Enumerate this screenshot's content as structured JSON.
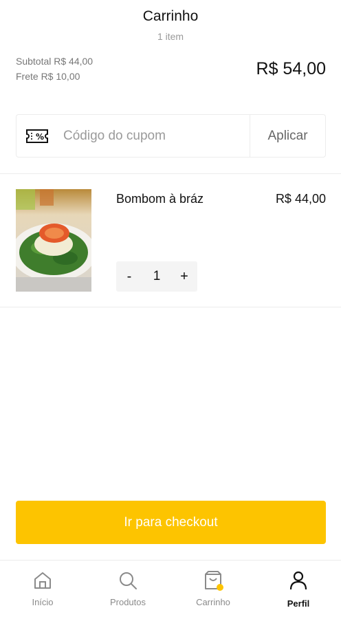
{
  "header": {
    "title": "Carrinho",
    "subtitle": "1 item"
  },
  "summary": {
    "subtotal": "Subtotal R$ 44,00",
    "shipping": "Frete R$ 10,00",
    "total": "R$ 54,00"
  },
  "coupon": {
    "placeholder": "Código do cupom",
    "value": "",
    "apply_label": "Aplicar",
    "icon": "ticket-percent-icon"
  },
  "cart": {
    "items": [
      {
        "name": "Bombom à bráz",
        "price": "R$ 44,00",
        "quantity": "1",
        "decrement": "-",
        "increment": "+"
      }
    ]
  },
  "checkout": {
    "label": "Ir para checkout"
  },
  "colors": {
    "accent": "#fdc400",
    "badge": "#fdc400"
  },
  "tabbar": {
    "tabs": [
      {
        "label": "Início",
        "icon": "home-icon"
      },
      {
        "label": "Produtos",
        "icon": "search-icon"
      },
      {
        "label": "Carrinho",
        "icon": "cart-bag-icon"
      },
      {
        "label": "Perfil",
        "icon": "user-icon",
        "active": true
      }
    ]
  }
}
